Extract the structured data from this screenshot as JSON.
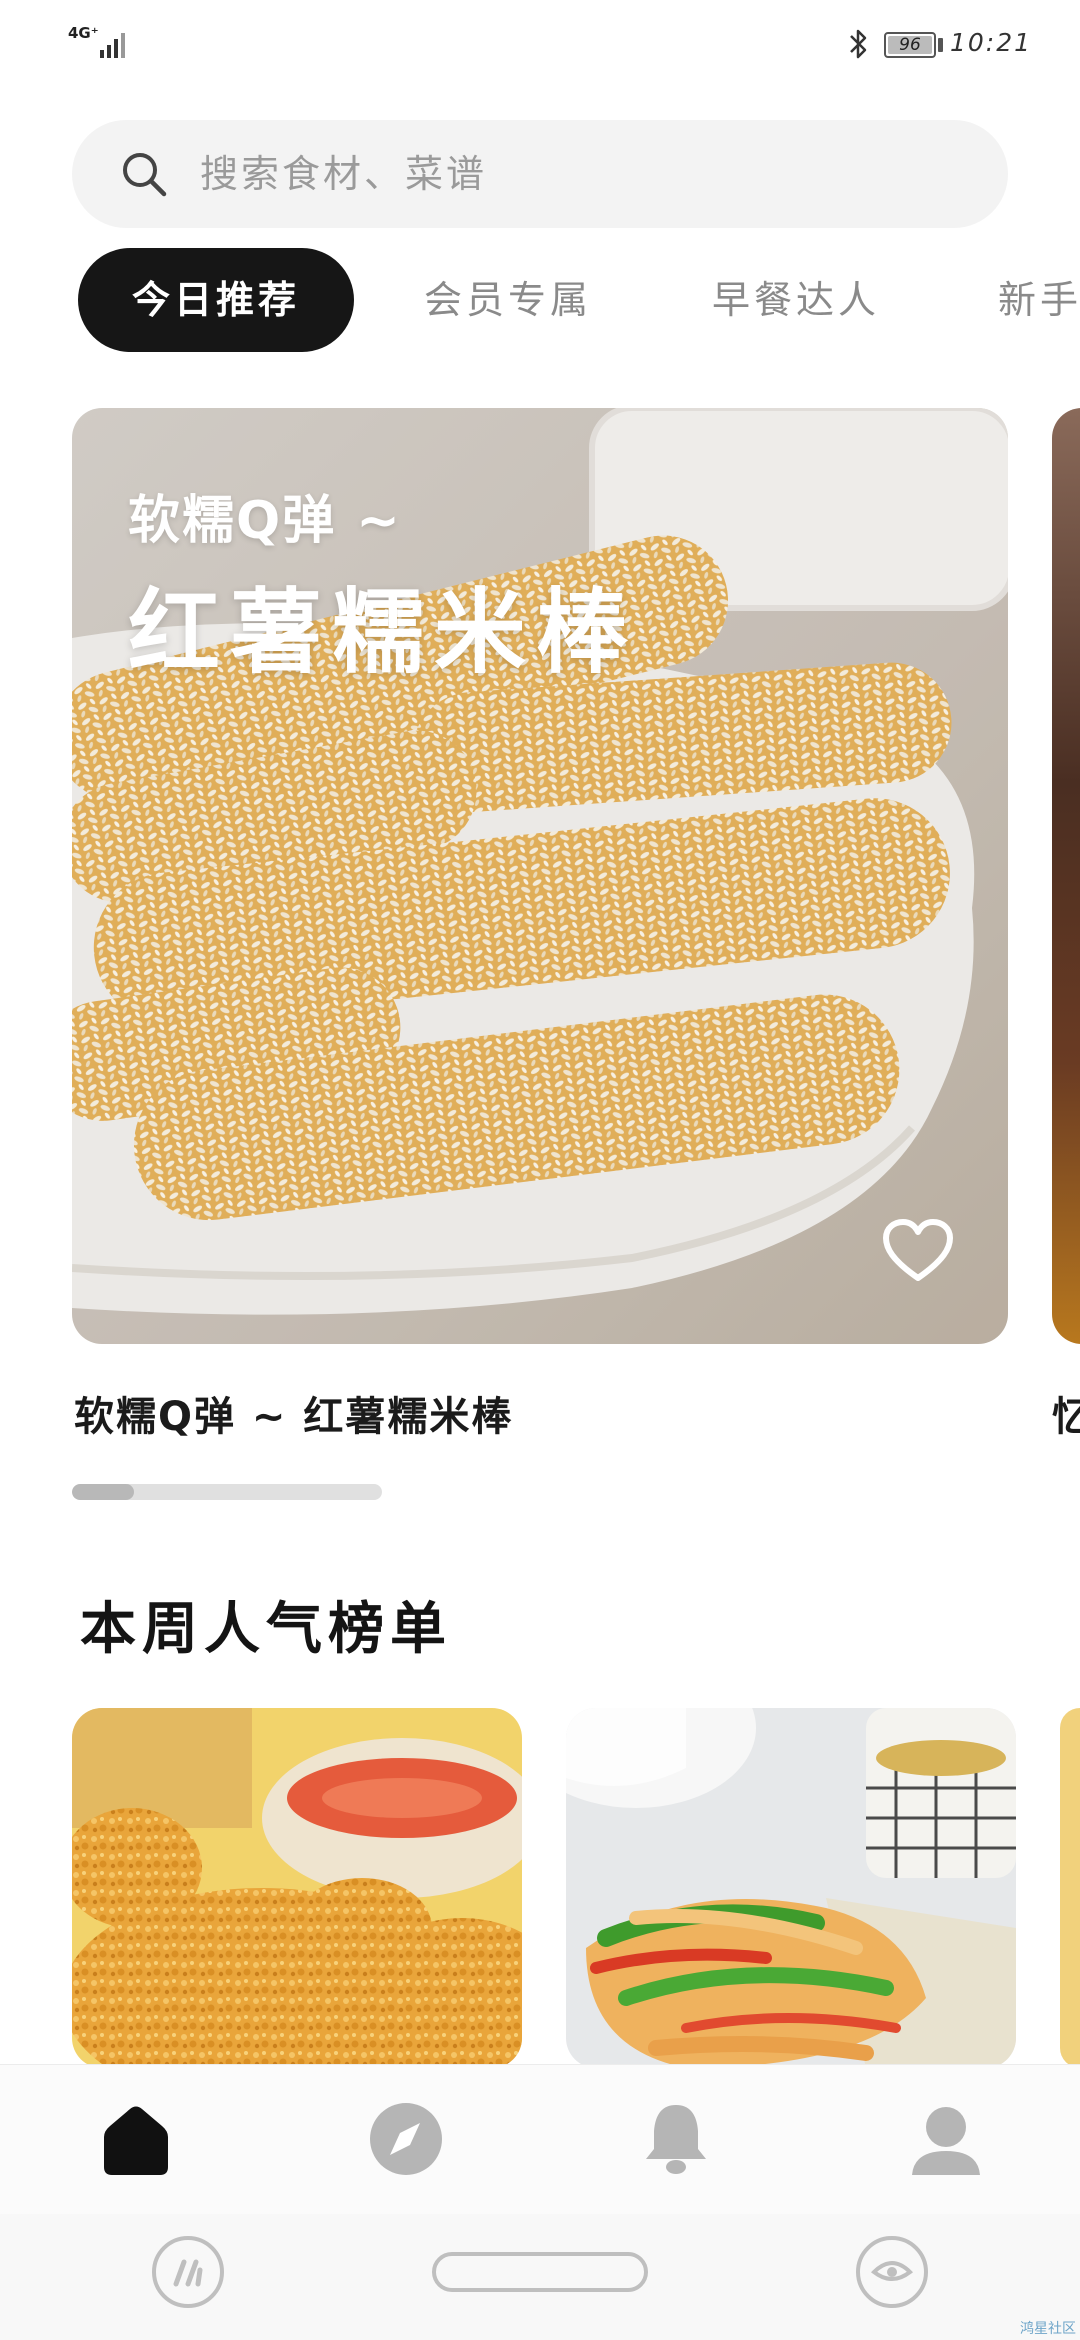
{
  "status_bar": {
    "network": "4G⁺",
    "battery_level": "96",
    "time": "10:21"
  },
  "search": {
    "placeholder": "搜索食材、菜谱"
  },
  "tabs": [
    {
      "label": "今日推荐",
      "active": true
    },
    {
      "label": "会员专属",
      "active": false
    },
    {
      "label": "早餐达人",
      "active": false
    },
    {
      "label": "新手",
      "active": false
    }
  ],
  "featured": {
    "overlay_subtitle": "软糯Q弹 ~",
    "overlay_title": "红薯糯米棒",
    "caption": "软糯Q弹 ~ 红薯糯米棒",
    "next_caption": "忆",
    "carousel_progress": 0.2
  },
  "section": {
    "title": "本周人气榜单"
  },
  "bottom_nav": [
    {
      "icon": "home-icon",
      "active": true
    },
    {
      "icon": "compass-icon",
      "active": false
    },
    {
      "icon": "bell-icon",
      "active": false
    },
    {
      "icon": "profile-icon",
      "active": false
    }
  ],
  "system_nav": {
    "left_icon": "app-switcher-icon",
    "right_icon": "eye-icon",
    "watermark": "鸿星社区"
  },
  "colors": {
    "tab_active_bg": "#161616",
    "search_bg": "#f3f3f3",
    "nav_active": "#111111",
    "nav_inactive": "#b5b5b5"
  }
}
